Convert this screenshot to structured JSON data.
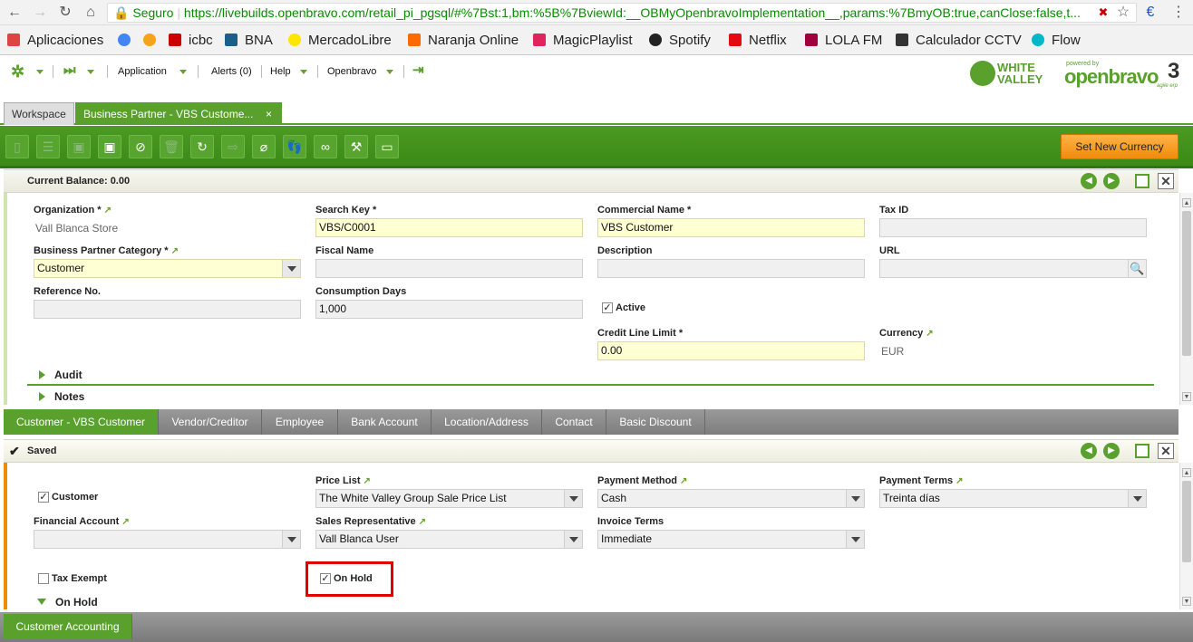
{
  "browser": {
    "secure_label": "Seguro",
    "url": "https://livebuilds.openbravo.com/retail_pi_pgsql/#%7Bst:1,bm:%5B%7BviewId:__OBMyOpenbravoImplementation__,params:%7BmyOB:true,canClose:false,t...",
    "bookmarks": [
      "Aplicaciones",
      "icbc",
      "BNA",
      "MercadoLibre",
      "Naranja Online",
      "MagicPlaylist",
      "Spotify",
      "Netflix",
      "LOLA FM",
      "Calculador CCTV",
      "Flow"
    ]
  },
  "nav": {
    "application": "Application",
    "alerts": "Alerts (0)",
    "help": "Help",
    "openbravo": "Openbravo",
    "logo_white": "WHITE",
    "logo_valley": "VALLEY",
    "powered_by": "powered by",
    "ob_logo": "openbravo",
    "ob_version": "3",
    "agile": "agile erp"
  },
  "tabs": {
    "workspace": "Workspace",
    "active": "Business Partner - VBS Custome..."
  },
  "toolbar": {
    "set_currency": "Set New Currency"
  },
  "header": {
    "balance": "Current Balance: 0.00"
  },
  "bp": {
    "organization_label": "Organization *",
    "organization_value": "Vall Blanca Store",
    "search_key_label": "Search Key *",
    "search_key_value": "VBS/C0001",
    "commercial_name_label": "Commercial Name *",
    "commercial_name_value": "VBS Customer",
    "tax_id_label": "Tax ID",
    "tax_id_value": "",
    "category_label": "Business Partner Category *",
    "category_value": "Customer",
    "fiscal_name_label": "Fiscal Name",
    "fiscal_name_value": "",
    "description_label": "Description",
    "description_value": "",
    "url_label": "URL",
    "url_value": "",
    "reference_label": "Reference No.",
    "reference_value": "",
    "consumption_label": "Consumption Days",
    "consumption_value": "1,000",
    "active_label": "Active",
    "credit_label": "Credit Line Limit *",
    "credit_value": "0.00",
    "currency_label": "Currency",
    "currency_value": "EUR",
    "audit": "Audit",
    "notes": "Notes"
  },
  "subtabs": [
    "Customer - VBS Customer",
    "Vendor/Creditor",
    "Employee",
    "Bank Account",
    "Location/Address",
    "Contact",
    "Basic Discount"
  ],
  "customer": {
    "status": "Saved",
    "customer_label": "Customer",
    "price_list_label": "Price List",
    "price_list_value": "The White Valley Group Sale Price List",
    "payment_method_label": "Payment Method",
    "payment_method_value": "Cash",
    "payment_terms_label": "Payment Terms",
    "payment_terms_value": "Treinta días",
    "financial_label": "Financial Account",
    "financial_value": "",
    "sales_rep_label": "Sales Representative",
    "sales_rep_value": "Vall Blanca User",
    "invoice_terms_label": "Invoice Terms",
    "invoice_terms_value": "Immediate",
    "tax_exempt_label": "Tax Exempt",
    "on_hold_label": "On Hold",
    "on_hold_section": "On Hold"
  },
  "bottom": {
    "tab": "Customer Accounting"
  },
  "colors": {
    "green": "#4b9a23",
    "orange": "#f08b0a",
    "highlight": "#e00000"
  }
}
